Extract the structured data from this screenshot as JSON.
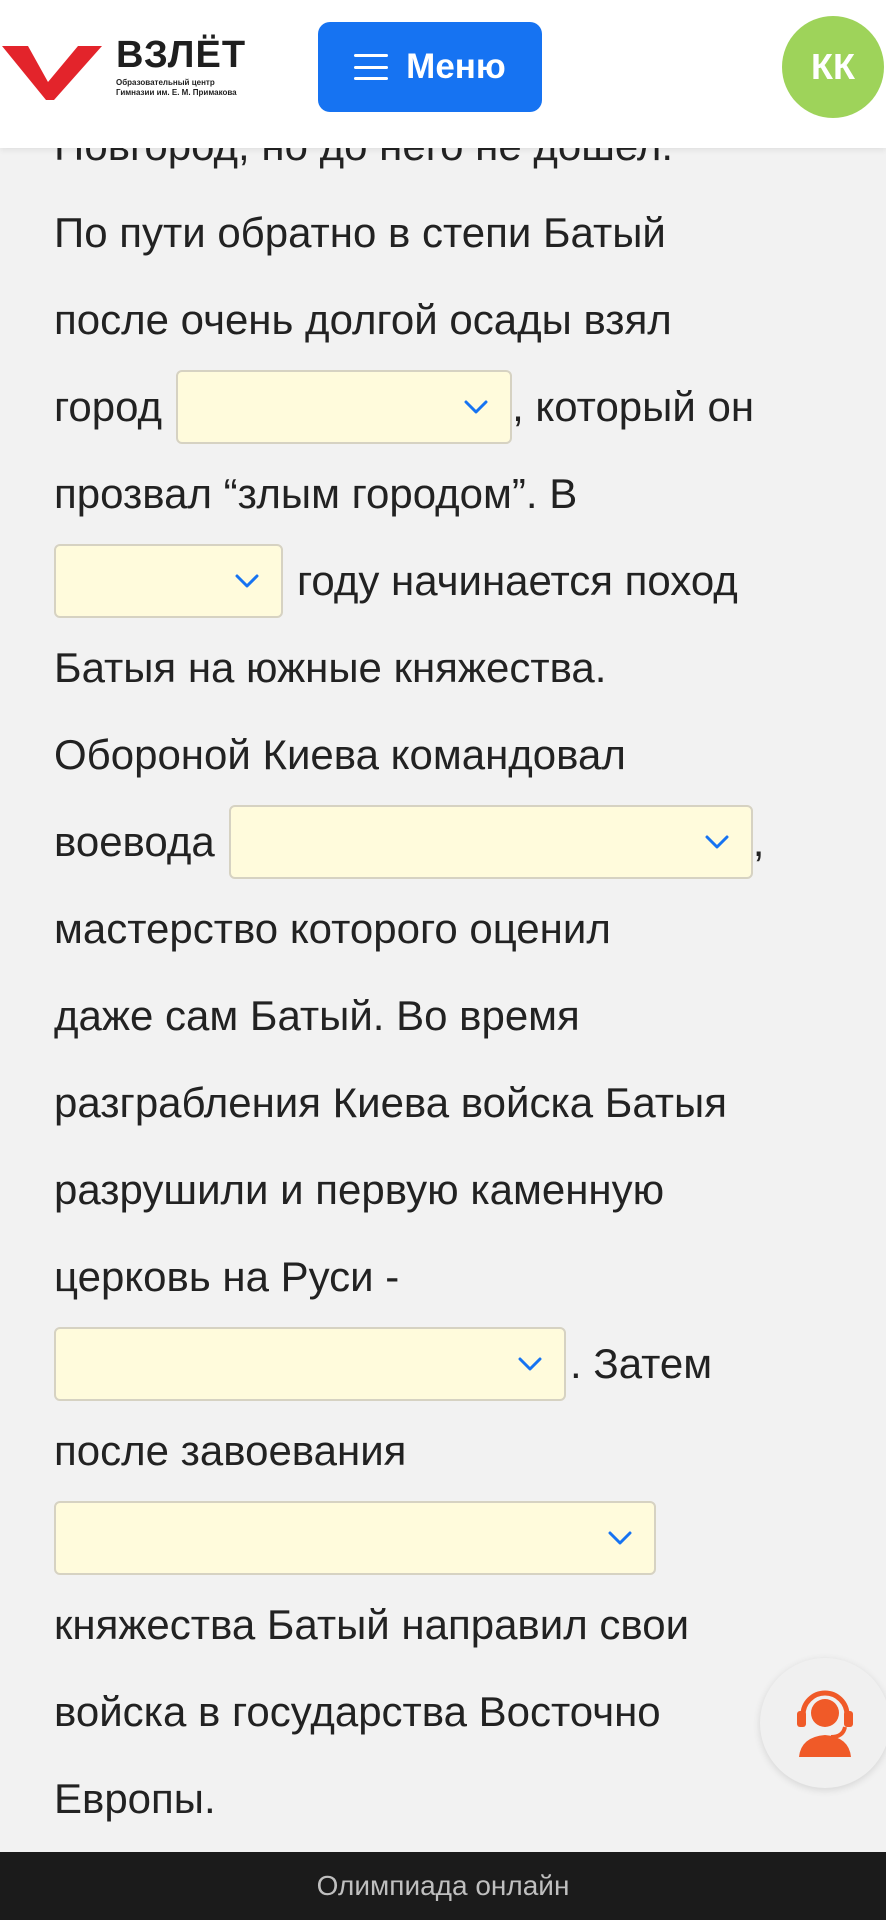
{
  "header": {
    "logo_title": "ВЗЛЁТ",
    "logo_subtitle_line1": "Образовательный центр",
    "logo_subtitle_line2": "Гимназии им. Е. М. Примакова",
    "menu_label": "Меню",
    "avatar_initials": "КК"
  },
  "text": {
    "line0": "Новгород, но до него не дошел.",
    "line1": "По пути обратно в степи Батый",
    "line2": "после очень долгой осады взял",
    "line3_before": "город",
    "line3_after": ", который он",
    "line4": "прозвал “злым городом”. В",
    "line5_after": "году начинается поход",
    "line6": "Батыя на южные княжества.",
    "line7": "Обороной Киева командовал",
    "line8_before": "воевода",
    "line8_after": ",",
    "line9": "мастерство которого оценил",
    "line10": "даже сам Батый. Во время",
    "line11": "разграбления Киева войска Батыя",
    "line12": "разрушили и первую каменную",
    "line13": "церковь на Руси -",
    "line14_after": ". Затем",
    "line15": "после завоевания",
    "line17": "княжества Батый направил свои",
    "line18": "войска в государства Восточно",
    "line19": "Европы."
  },
  "selects": {
    "city": "",
    "year": "",
    "voivode": "",
    "church": "",
    "principality": ""
  },
  "footer": {
    "label": "Олимпиада онлайн"
  },
  "colors": {
    "menu_button": "#1673f2",
    "avatar": "#9ed35a",
    "select_bg": "#fffbdc",
    "chevron": "#1673f2",
    "support_icon": "#f05a28",
    "footer_bg": "#1b1b1b"
  }
}
